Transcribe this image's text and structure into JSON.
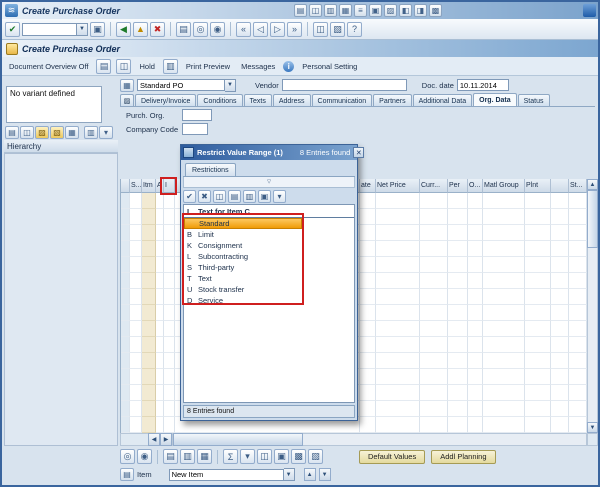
{
  "window": {
    "title": "Create Purchase Order"
  },
  "transaction": {
    "title": "Create Purchase Order"
  },
  "app_toolbar": {
    "document_overview": "Document Overview Off",
    "hold": "Hold",
    "print_preview": "Print Preview",
    "messages": "Messages",
    "personal_setting": "Personal Setting"
  },
  "order_form": {
    "order_type_value": "Standard PO",
    "vendor_label": "Vendor",
    "vendor_value": "",
    "doc_date_label": "Doc. date",
    "doc_date_value": "10.11.2014"
  },
  "sidebar": {
    "no_variant_text": "No variant defined",
    "hierarchy_label": "Hierarchy"
  },
  "header_tabs": [
    {
      "label": "Delivery/Invoice",
      "active": false
    },
    {
      "label": "Conditions",
      "active": false
    },
    {
      "label": "Texts",
      "active": false
    },
    {
      "label": "Address",
      "active": false
    },
    {
      "label": "Communication",
      "active": false
    },
    {
      "label": "Partners",
      "active": false
    },
    {
      "label": "Additional Data",
      "active": false
    },
    {
      "label": "Org. Data",
      "active": true
    },
    {
      "label": "Status",
      "active": false
    }
  ],
  "org_data": {
    "purch_org_label": "Purch. Org.",
    "purch_org_value": "",
    "company_code_label": "Company Code",
    "company_code_value": ""
  },
  "item_table": {
    "headers": [
      "",
      "S...",
      "Itm",
      "A",
      "I",
      "",
      "ate",
      "Net Price",
      "Curr...",
      "Per",
      "O...",
      "Matl Group",
      "Plnt",
      "",
      "St..."
    ]
  },
  "value_help_popup": {
    "title": "Restrict Value Range (1)",
    "title_count": "8 Entries found",
    "tab_label": "Restrictions",
    "column_code_header": "I",
    "column_text_header": "Text for Item C",
    "entries": [
      {
        "code": "",
        "label": "Standard",
        "selected": true
      },
      {
        "code": "B",
        "label": "Limit",
        "selected": false
      },
      {
        "code": "K",
        "label": "Consignment",
        "selected": false
      },
      {
        "code": "L",
        "label": "Subcontracting",
        "selected": false
      },
      {
        "code": "S",
        "label": "Third-party",
        "selected": false
      },
      {
        "code": "T",
        "label": "Text",
        "selected": false
      },
      {
        "code": "U",
        "label": "Stock transfer",
        "selected": false
      },
      {
        "code": "D",
        "label": "Service",
        "selected": false
      }
    ],
    "status_text": "8 Entries found"
  },
  "footer": {
    "default_values_label": "Default Values",
    "addl_planning_label": "Addl Planning",
    "item_label": "Item",
    "item_value": "New Item"
  }
}
